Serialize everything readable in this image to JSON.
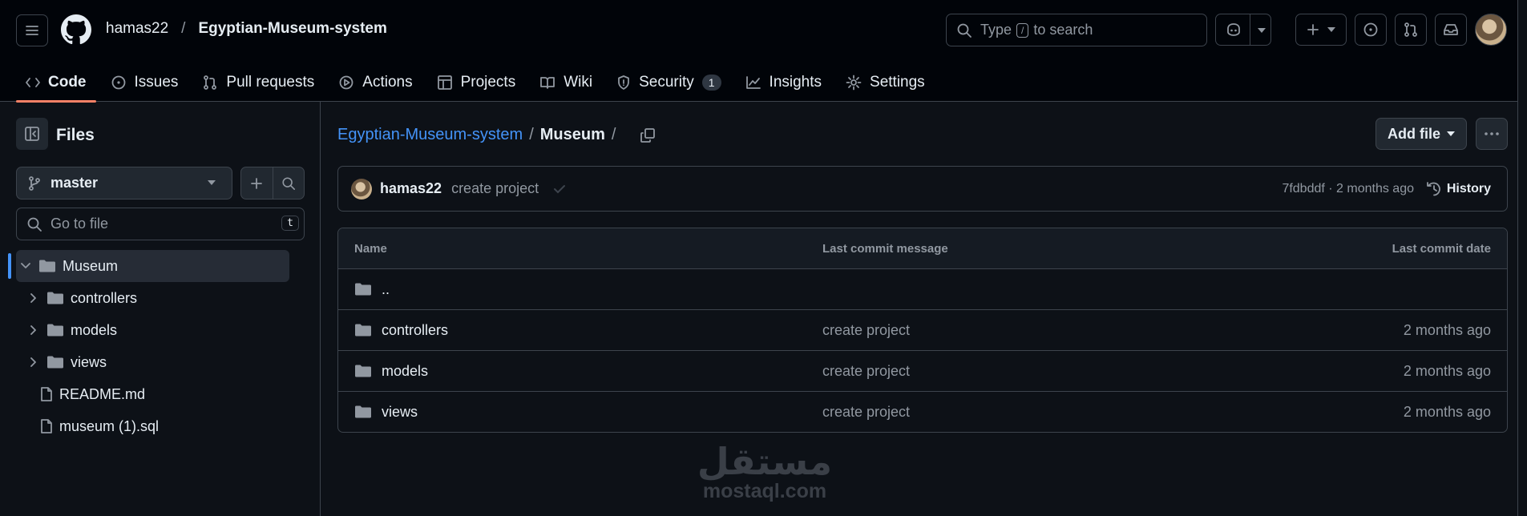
{
  "header": {
    "owner": "hamas22",
    "separator": "/",
    "repo": "Egyptian-Museum-system",
    "search": {
      "before": "Type",
      "key": "/",
      "after": "to search"
    }
  },
  "tabs": [
    {
      "label": "Code",
      "icon": "code-icon",
      "active": true
    },
    {
      "label": "Issues",
      "icon": "issue-icon"
    },
    {
      "label": "Pull requests",
      "icon": "pull-request-icon"
    },
    {
      "label": "Actions",
      "icon": "play-icon"
    },
    {
      "label": "Projects",
      "icon": "table-icon"
    },
    {
      "label": "Wiki",
      "icon": "book-icon"
    },
    {
      "label": "Security",
      "icon": "shield-icon",
      "count": "1"
    },
    {
      "label": "Insights",
      "icon": "graph-icon"
    },
    {
      "label": "Settings",
      "icon": "gear-icon"
    }
  ],
  "sidebar": {
    "title": "Files",
    "branch": "master",
    "goto_placeholder": "Go to file",
    "goto_key": "t",
    "tree": [
      {
        "label": "Museum",
        "type": "folder",
        "expanded": true
      },
      {
        "label": "controllers",
        "type": "folder"
      },
      {
        "label": "models",
        "type": "folder"
      },
      {
        "label": "views",
        "type": "folder"
      },
      {
        "label": "README.md",
        "type": "file"
      },
      {
        "label": "museum (1).sql",
        "type": "file"
      }
    ]
  },
  "main": {
    "breadcrumb_repo": "Egyptian-Museum-system",
    "breadcrumb_sep": "/",
    "breadcrumb_current": "Museum",
    "breadcrumb_trail": "/",
    "add_file": "Add file",
    "commit": {
      "author": "hamas22",
      "message": "create project",
      "meta": "7fdbddf · 2 months ago",
      "history": "History"
    },
    "table": {
      "headers": {
        "name": "Name",
        "message": "Last commit message",
        "date": "Last commit date"
      },
      "parent": "..",
      "rows": [
        {
          "name": "controllers",
          "message": "create project",
          "date": "2 months ago"
        },
        {
          "name": "models",
          "message": "create project",
          "date": "2 months ago"
        },
        {
          "name": "views",
          "message": "create project",
          "date": "2 months ago"
        }
      ]
    }
  },
  "watermark": {
    "arabic": "مستقل",
    "latin": "mostaql.com"
  },
  "colors": {
    "bg": "#0d1117",
    "header_bg": "#010409",
    "border": "#3d444d",
    "link": "#4493f8",
    "accent": "#f78166",
    "muted": "#9198a1"
  }
}
